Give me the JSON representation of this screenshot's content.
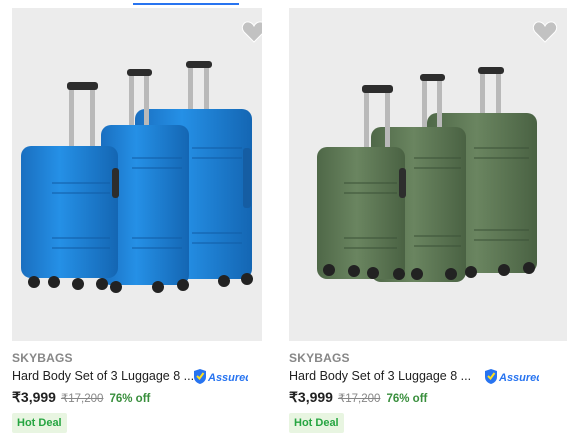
{
  "colors": {
    "card1_luggage": "#1f86d9",
    "card2_luggage": "#5f7a55",
    "price_off": "#388e3c",
    "deal_text": "#26a541",
    "deal_bg": "#e8f5e1",
    "assured_blue": "#2874f0"
  },
  "products": [
    {
      "brand": "SKYBAGS",
      "title": "Hard Body Set of 3 Luggage 8 ...",
      "assured_label": "Assured",
      "price": "₹3,999",
      "mrp": "₹17,200",
      "discount": "76% off",
      "deal": "Hot Deal",
      "wishlist_icon": "heart-icon"
    },
    {
      "brand": "SKYBAGS",
      "title": "Hard Body Set of 3 Luggage 8 ...",
      "assured_label": "Assured",
      "price": "₹3,999",
      "mrp": "₹17,200",
      "discount": "76% off",
      "deal": "Hot Deal",
      "wishlist_icon": "heart-icon"
    }
  ]
}
